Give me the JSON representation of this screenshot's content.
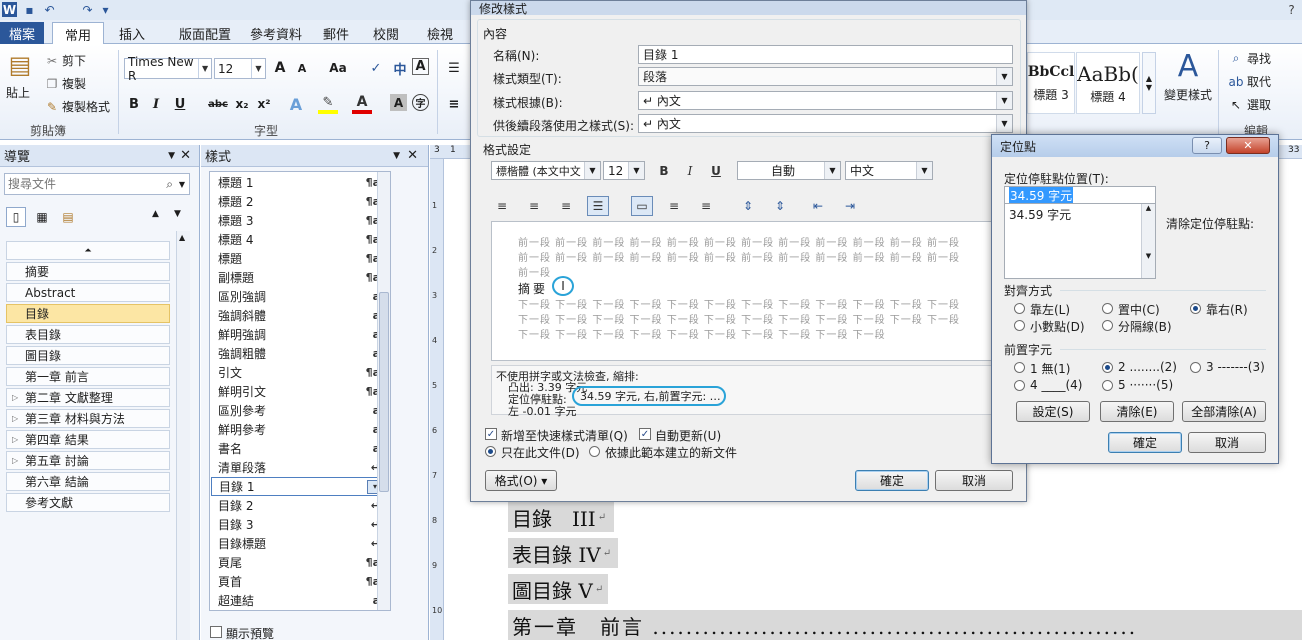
{
  "titlebar": {
    "app_icon": "W",
    "undo_glyph": "↶",
    "redo_glyph": "↷",
    "more_glyph": "▾"
  },
  "tabs": {
    "file": "檔案",
    "home": "常用",
    "insert": "插入",
    "layout": "版面配置",
    "references": "參考資料",
    "mailings": "郵件",
    "review": "校閱",
    "view": "檢視"
  },
  "ribbon": {
    "clipboard": {
      "paste": "貼上",
      "cut": "剪下",
      "copy": "複製",
      "format_painter": "複製格式",
      "label": "剪貼簿"
    },
    "font": {
      "name": "Times New R",
      "size": "12",
      "label": "字型",
      "bold": "B",
      "italic": "I",
      "underline": "U",
      "strike": "abc",
      "sub": "x₂",
      "sup": "x²",
      "grow": "A",
      "shrink": "A",
      "case": "Aa",
      "clear": "A"
    },
    "styles_gallery": [
      {
        "sample": "BbCcl",
        "name": "標題 3"
      },
      {
        "sample": "AaBb(",
        "name": "標題 4"
      }
    ],
    "change_styles": "變更樣式",
    "editing": {
      "find": "尋找",
      "replace": "取代",
      "select": "選取",
      "label": "編輯"
    }
  },
  "nav_pane": {
    "title": "導覽",
    "search_placeholder": "搜尋文件",
    "items": [
      {
        "label": "摘要",
        "expand": ""
      },
      {
        "label": "Abstract",
        "expand": ""
      },
      {
        "label": "目錄",
        "expand": ""
      },
      {
        "label": "表目錄",
        "expand": ""
      },
      {
        "label": "圖目錄",
        "expand": ""
      },
      {
        "label": "第一章 前言",
        "expand": ""
      },
      {
        "label": "第二章 文獻整理",
        "expand": "▷"
      },
      {
        "label": "第三章 材料與方法",
        "expand": "▷"
      },
      {
        "label": "第四章 結果",
        "expand": "▷"
      },
      {
        "label": "第五章 討論",
        "expand": "▷"
      },
      {
        "label": "第六章 結論",
        "expand": ""
      },
      {
        "label": "參考文獻",
        "expand": ""
      }
    ]
  },
  "styles_pane": {
    "title": "樣式",
    "items": [
      {
        "label": "標題 1",
        "mark": "¶a"
      },
      {
        "label": "標題 2",
        "mark": "¶a"
      },
      {
        "label": "標題 3",
        "mark": "¶a"
      },
      {
        "label": "標題 4",
        "mark": "¶a"
      },
      {
        "label": "標題",
        "mark": "¶a"
      },
      {
        "label": "副標題",
        "mark": "¶a"
      },
      {
        "label": "區別強調",
        "mark": "a"
      },
      {
        "label": "強調斜體",
        "mark": "a"
      },
      {
        "label": "鮮明強調",
        "mark": "a"
      },
      {
        "label": "強調粗體",
        "mark": "a"
      },
      {
        "label": "引文",
        "mark": "¶a"
      },
      {
        "label": "鮮明引文",
        "mark": "¶a"
      },
      {
        "label": "區別參考",
        "mark": "a"
      },
      {
        "label": "鮮明參考",
        "mark": "a"
      },
      {
        "label": "書名",
        "mark": "a"
      },
      {
        "label": "清單段落",
        "mark": "↵"
      },
      {
        "label": "目錄 1",
        "mark": "▾"
      },
      {
        "label": "目錄 2",
        "mark": "↵"
      },
      {
        "label": "目錄 3",
        "mark": "↵"
      },
      {
        "label": "目錄標題",
        "mark": "↵"
      },
      {
        "label": "頁尾",
        "mark": "¶a"
      },
      {
        "label": "頁首",
        "mark": "¶a"
      },
      {
        "label": "超連結",
        "mark": "a"
      }
    ],
    "show_preview": "顯示預覽"
  },
  "ruler": {
    "marks": [
      "3",
      "1",
      "33"
    ]
  },
  "vruler": {
    "marks": [
      "1",
      "2",
      "3",
      "4",
      "5",
      "6",
      "7",
      "8",
      "9",
      "10"
    ]
  },
  "document": {
    "lines": [
      {
        "text": "目錄　III",
        "mark": "↵"
      },
      {
        "text": "表目錄 IV",
        "mark": "↵"
      },
      {
        "text": "圖目錄 V",
        "mark": "↵"
      },
      {
        "text": "第一章　前言 ..........................................................",
        "mark": ""
      }
    ]
  },
  "modify_dialog": {
    "title": "修改樣式",
    "properties_label": "內容",
    "name_label": "名稱(N):",
    "name_value": "目錄 1",
    "type_label": "樣式類型(T):",
    "type_value": "段落",
    "based_label": "樣式根據(B):",
    "based_value": "↵ 內文",
    "next_label": "供後續段落使用之樣式(S):",
    "next_value": "↵ 內文",
    "format_label": "格式設定",
    "font_value": "標楷體 (本文中文",
    "size_value": "12",
    "bold": "B",
    "italic": "I",
    "underline": "U",
    "color_value": "自動",
    "lang_value": "中文",
    "preview_prev": "前一段 前一段 前一段 前一段 前一段 前一段 前一段 前一段 前一段 前一段 前一段 前一段",
    "preview_prev_short": "前一段",
    "preview_sample": "摘要",
    "preview_page": "I",
    "preview_next": "下一段 下一段 下一段 下一段 下一段 下一段 下一段 下一段 下一段 下一段 下一段 下一段",
    "preview_next_short": "下一段 下一段 下一段 下一段 下一段 下一段 下一段 下一段 下一段 下一段",
    "desc_line1": "不使用拼字或文法檢查, 縮排:",
    "desc_line2": "凸出: 3.39 字元",
    "desc_line3_prefix": "定位停駐點:",
    "desc_line3_value": "34.59 字元, 右,前置字元: …",
    "desc_line4": "左 -0.01 字元",
    "add_gallery": "新增至快速樣式清單(Q)",
    "auto_update": "自動更新(U)",
    "only_doc": "只在此文件(D)",
    "new_docs": "依據此範本建立的新文件",
    "format_button": "格式(O) ▾",
    "ok": "確定",
    "cancel": "取消"
  },
  "tabs_dialog": {
    "title": "定位點",
    "help": "?",
    "close": "✕",
    "position_label": "定位停駐點位置(T):",
    "position_value": "34.59 字元",
    "list": [
      "34.59 字元"
    ],
    "clear_label": "清除定位停駐點:",
    "alignment_label": "對齊方式",
    "align_left": "靠左(L)",
    "align_center": "置中(C)",
    "align_right": "靠右(R)",
    "align_decimal": "小數點(D)",
    "align_bar": "分隔線(B)",
    "leader_label": "前置字元",
    "leader1": "1 無(1)",
    "leader2": "2 ........(2)",
    "leader3": "3 -------(3)",
    "leader4": "4 ____(4)",
    "leader5": "5 ·······(5)",
    "set": "設定(S)",
    "clear": "清除(E)",
    "clear_all": "全部清除(A)",
    "ok": "確定",
    "cancel": "取消"
  }
}
